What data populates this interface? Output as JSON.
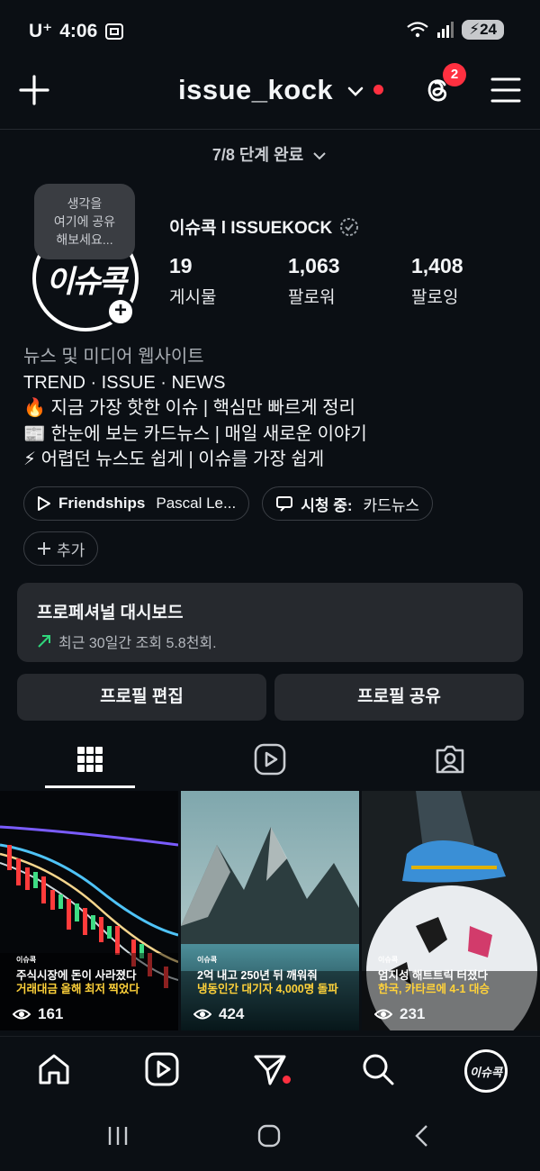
{
  "status_bar": {
    "carrier": "U⁺",
    "time": "4:06",
    "battery": "24"
  },
  "header": {
    "username": "issue_kock",
    "notification_count": "2"
  },
  "setup_progress": "7/8 단계 완료",
  "note_bubble": {
    "line1": "생각을",
    "line2": "여기에 공유",
    "line3": "해보세요..."
  },
  "profile": {
    "avatar_text": "이슈콕",
    "display_name": "이슈콕 l ISSUEKOCK",
    "stats": [
      {
        "value": "19",
        "label": "게시물"
      },
      {
        "value": "1,063",
        "label": "팔로워"
      },
      {
        "value": "1,408",
        "label": "팔로잉"
      }
    ],
    "category": "뉴스 및 미디어 웹사이트",
    "bio": [
      "TREND · ISSUE · NEWS",
      "🔥 지금 가장 핫한 이슈 | 핵심만 빠르게 정리",
      "📰 한눈에 보는 카드뉴스 | 매일 새로운 이야기",
      "⚡ 어렵던 뉴스도 쉽게 | 이슈를 가장 쉽게"
    ]
  },
  "chips": {
    "music_title": "Friendships",
    "music_artist": "Pascal Le...",
    "watching_label": "시청 중:",
    "watching_value": "카드뉴스",
    "add_label": "추가"
  },
  "dashboard": {
    "title": "프로페셔널 대시보드",
    "subtitle": "최근 30일간 조회 5.8천회."
  },
  "buttons": {
    "edit_profile": "프로필 편집",
    "share_profile": "프로필 공유"
  },
  "posts": [
    {
      "brand": "이슈콕",
      "line1": "주식시장에 돈이 사라졌다",
      "line2": "거래대금 올해 최저 찍었다",
      "views": "161"
    },
    {
      "brand": "이슈콕",
      "line1": "2억 내고 250년 뒤 깨워줘",
      "line2": "냉동인간 대기자 4,000명 돌파",
      "views": "424"
    },
    {
      "brand": "이슈콕",
      "line1": "엄지성 해트트릭 터졌다",
      "line2": "한국, 카타르에 4-1 대승",
      "views": "231"
    }
  ],
  "nav_avatar_text": "이슈콕",
  "colors": {
    "background": "#0b0f14",
    "card": "#26292e",
    "accent_red": "#ff3040",
    "highlight_yellow": "#ffd23a",
    "trend_green": "#2fd67b"
  }
}
